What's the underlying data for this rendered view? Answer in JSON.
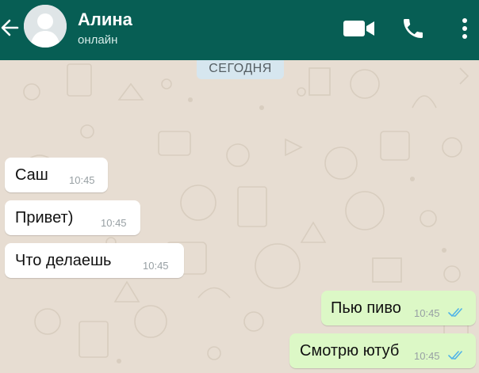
{
  "header": {
    "contact_name": "Алина",
    "status": "онлайн",
    "icons": [
      "back-arrow-icon",
      "avatar",
      "video-call-icon",
      "phone-call-icon",
      "more-options-icon"
    ],
    "bg_color": "#075e54"
  },
  "date_chip": "СЕГОДНЯ",
  "messages": [
    {
      "direction": "incoming",
      "text": "Саш",
      "time": "10:45"
    },
    {
      "direction": "incoming",
      "text": "Привет)",
      "time": "10:45"
    },
    {
      "direction": "incoming",
      "text": "Что делаешь",
      "time": "10:45"
    },
    {
      "direction": "outgoing",
      "text": "Пью пиво",
      "time": "10:45",
      "status": "read"
    },
    {
      "direction": "outgoing",
      "text": "Смотрю ютуб",
      "time": "10:45",
      "status": "read"
    }
  ],
  "colors": {
    "incoming_bubble": "#ffffff",
    "outgoing_bubble": "#dcf8c6",
    "read_ticks": "#4fb3e8",
    "wallpaper": "#e7ddd2"
  }
}
